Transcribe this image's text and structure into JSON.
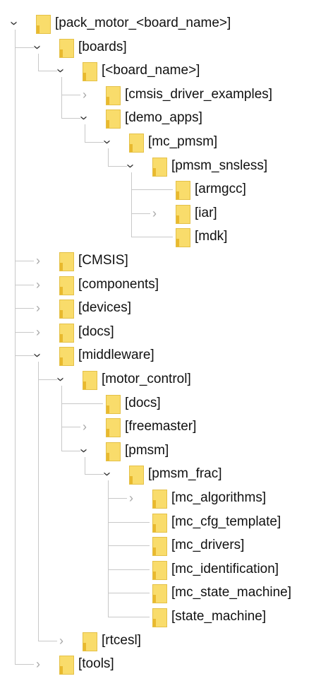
{
  "tree": [
    {
      "label": "[pack_motor_<board_name>]",
      "depth": 0,
      "state": "expanded"
    },
    {
      "label": "[boards]",
      "depth": 1,
      "state": "expanded"
    },
    {
      "label": "[<board_name>]",
      "depth": 2,
      "state": "expanded"
    },
    {
      "label": "[cmsis_driver_examples]",
      "depth": 3,
      "state": "collapsed"
    },
    {
      "label": "[demo_apps]",
      "depth": 3,
      "state": "expanded"
    },
    {
      "label": "[mc_pmsm]",
      "depth": 4,
      "state": "expanded"
    },
    {
      "label": "[pmsm_snsless]",
      "depth": 5,
      "state": "expanded"
    },
    {
      "label": "[armgcc]",
      "depth": 6,
      "state": "leaf"
    },
    {
      "label": "[iar]",
      "depth": 6,
      "state": "collapsed"
    },
    {
      "label": "[mdk]",
      "depth": 6,
      "state": "leaf"
    },
    {
      "label": "[CMSIS]",
      "depth": 1,
      "state": "collapsed"
    },
    {
      "label": "[components]",
      "depth": 1,
      "state": "collapsed"
    },
    {
      "label": "[devices]",
      "depth": 1,
      "state": "collapsed"
    },
    {
      "label": "[docs]",
      "depth": 1,
      "state": "collapsed"
    },
    {
      "label": "[middleware]",
      "depth": 1,
      "state": "expanded"
    },
    {
      "label": "[motor_control]",
      "depth": 2,
      "state": "expanded"
    },
    {
      "label": "[docs]",
      "depth": 3,
      "state": "leaf"
    },
    {
      "label": "[freemaster]",
      "depth": 3,
      "state": "collapsed"
    },
    {
      "label": "[pmsm]",
      "depth": 3,
      "state": "expanded"
    },
    {
      "label": "[pmsm_frac]",
      "depth": 4,
      "state": "expanded"
    },
    {
      "label": "[mc_algorithms]",
      "depth": 5,
      "state": "collapsed"
    },
    {
      "label": "[mc_cfg_template]",
      "depth": 5,
      "state": "leaf"
    },
    {
      "label": "[mc_drivers]",
      "depth": 5,
      "state": "leaf"
    },
    {
      "label": "[mc_identification]",
      "depth": 5,
      "state": "leaf"
    },
    {
      "label": "[mc_state_machine]",
      "depth": 5,
      "state": "leaf"
    },
    {
      "label": "[state_machine]",
      "depth": 5,
      "state": "leaf"
    },
    {
      "label": "[rtcesl]",
      "depth": 2,
      "state": "collapsed"
    },
    {
      "label": "[tools]",
      "depth": 1,
      "state": "collapsed"
    }
  ],
  "colors": {
    "folder_fill": "#f9dc6b",
    "folder_shade": "#e9b92e",
    "guide_line": "#c8c8c8",
    "chevron_expanded": "#333333",
    "chevron_collapsed": "#a8a8a8"
  },
  "icons": {
    "expanded": "chevron-down-icon",
    "collapsed": "chevron-right-icon",
    "folder": "folder-icon"
  }
}
